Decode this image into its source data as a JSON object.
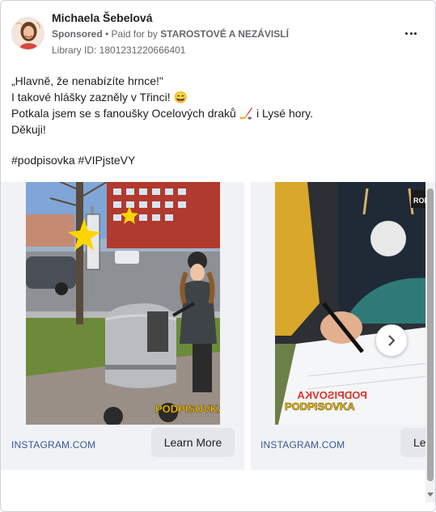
{
  "post": {
    "author_name": "Michaela Šebelová",
    "sponsored_label": "Sponsored",
    "separator": " • ",
    "paid_for_prefix": "Paid for by ",
    "payer_name": "STAROSTOVÉ A NEZÁVISLÍ",
    "library_id": "Library ID: 1801231220666401",
    "body_lines": [
      "„Hlavně, že nenabízíte hrnce!\"",
      "I takové hlášky zazněly v Třinci! 😄",
      "Potkala jsem se s fanoušky Ocelových draků 🏒 i Lysé hory.",
      "Děkuji!"
    ],
    "hashtags": "#podpisovka #VIPjsteVY"
  },
  "carousel": {
    "cards": [
      {
        "domain": "INSTAGRAM.COM",
        "cta": "Learn More",
        "sticker": "PODPISOVKA"
      },
      {
        "domain": "INSTAGRAM.COM",
        "cta": "Le",
        "sticker": "PODPISOVKA"
      }
    ],
    "next_icon": "chevron-right-icon"
  },
  "icons": {
    "more": "more-dots-icon",
    "avatar": "avatar"
  },
  "colors": {
    "link": "#385898",
    "muted": "#65676b",
    "card_bg": "#f0f2f5",
    "button_bg": "#e4e6eb",
    "sticker_yellow": "#ffd500"
  }
}
